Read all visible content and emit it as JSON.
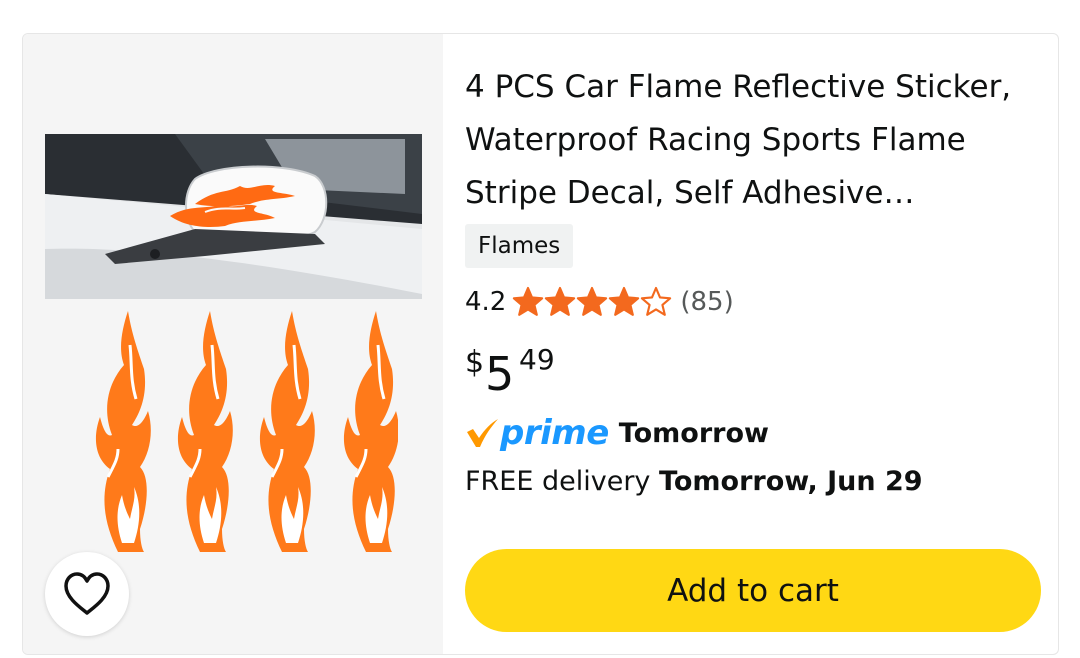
{
  "product": {
    "title": "4 PCS Car Flame Reflective Sticker, Waterproof Racing Sports Flame Stripe Decal, Self Adhesive…",
    "badge": "Flames",
    "rating_value": "4.2",
    "rating_stars": 4.2,
    "rating_count": "(85)",
    "price_symbol": "$",
    "price_whole": "5",
    "price_fraction": "49",
    "prime_label": "prime",
    "prime_delivery": "Tomorrow",
    "delivery_prefix": "FREE delivery",
    "delivery_date": "Tomorrow, Jun 29",
    "cart_button": "Add to cart"
  },
  "icons": {
    "favorite": "heart-outline-icon",
    "prime_check": "prime-check-icon",
    "star": "star-icon"
  },
  "colors": {
    "star": "#f3691e",
    "prime_blue": "#1a98ff",
    "prime_check": "#ff9900",
    "cart_button": "#ffd814",
    "flame": "#ff7a1a",
    "image_background": "#f5f5f5"
  }
}
